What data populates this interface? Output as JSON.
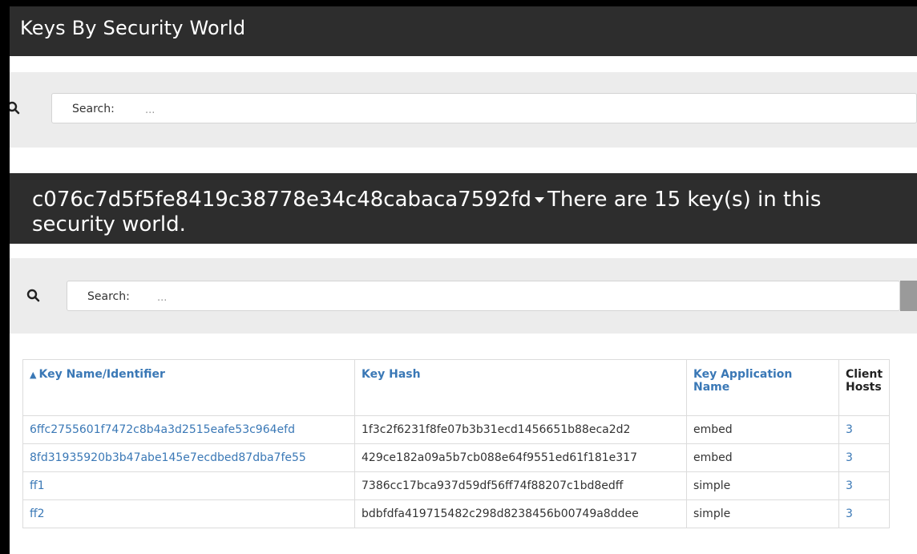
{
  "header": {
    "title": "Keys By Security World"
  },
  "search_top": {
    "label": "Search:",
    "placeholder": "..."
  },
  "world": {
    "id": "c076c7d5f5fe8419c38778e34c48cabaca7592fd",
    "summary": "There are 15 key(s) in this security world."
  },
  "search_keys": {
    "label": "Search:",
    "placeholder": "..."
  },
  "table": {
    "columns": [
      "Key Name/Identifier",
      "Key Hash",
      "Key Application Name",
      "Client Hosts"
    ],
    "sort_indicator": "▲",
    "rows": [
      {
        "name": "6ffc2755601f7472c8b4a3d2515eafe53c964efd",
        "hash": "1f3c2f6231f8fe07b3b31ecd1456651b88eca2d2",
        "app": "embed",
        "hosts": "3"
      },
      {
        "name": "8fd31935920b3b47abe145e7ecdbed87dba7fe55",
        "hash": "429ce182a09a5b7cb088e64f9551ed61f181e317",
        "app": "embed",
        "hosts": "3"
      },
      {
        "name": "ff1",
        "hash": "7386cc17bca937d59df56ff74f88207c1bd8edff",
        "app": "simple",
        "hosts": "3"
      },
      {
        "name": "ff2",
        "hash": "bdbfdfa419715482c298d8238456b00749a8ddee",
        "app": "simple",
        "hosts": "3"
      }
    ]
  },
  "colors": {
    "dark_bar": "#2d2d2d",
    "link": "#3a78b6",
    "band": "#ececec"
  }
}
